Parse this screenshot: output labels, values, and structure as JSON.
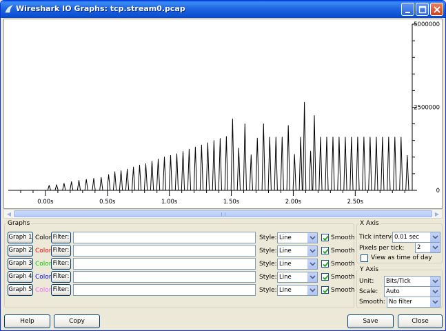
{
  "window": {
    "title": "Wireshark IO Graphs: tcp.stream0.pcap"
  },
  "chart_data": {
    "type": "line",
    "x_tick_labels": [
      "0.00s",
      "0.50s",
      "1.00s",
      "1.50s",
      "2.00s",
      "2.50s"
    ],
    "x_ticks": [
      0.0,
      0.5,
      1.0,
      1.5,
      2.0,
      2.5
    ],
    "y_tick_labels": [
      "5000000",
      "2500000",
      "0"
    ],
    "y_ticks": [
      5000000,
      2500000,
      0
    ],
    "xlim": [
      -0.3,
      2.96
    ],
    "ylim": [
      0,
      5000000
    ],
    "peaks": [
      [
        0.03,
        150000
      ],
      [
        0.09,
        170000
      ],
      [
        0.15,
        210000
      ],
      [
        0.21,
        260000
      ],
      [
        0.27,
        300000
      ],
      [
        0.33,
        330000
      ],
      [
        0.39,
        360000
      ],
      [
        0.45,
        390000
      ],
      [
        0.51,
        470000
      ],
      [
        0.56,
        560000
      ],
      [
        0.61,
        590000
      ],
      [
        0.66,
        640000
      ],
      [
        0.71,
        700000
      ],
      [
        0.76,
        760000
      ],
      [
        0.81,
        800000
      ],
      [
        0.86,
        880000
      ],
      [
        0.91,
        940000
      ],
      [
        0.96,
        1000000
      ],
      [
        1.01,
        1050000
      ],
      [
        1.06,
        1100000
      ],
      [
        1.11,
        1170000
      ],
      [
        1.16,
        1240000
      ],
      [
        1.21,
        1300000
      ],
      [
        1.26,
        1360000
      ],
      [
        1.31,
        1430000
      ],
      [
        1.36,
        1500000
      ],
      [
        1.41,
        1560000
      ],
      [
        1.46,
        1620000
      ],
      [
        1.51,
        2150000
      ],
      [
        1.56,
        1270000
      ],
      [
        1.61,
        2000000
      ],
      [
        1.66,
        1070000
      ],
      [
        1.71,
        1570000
      ],
      [
        1.76,
        2000000
      ],
      [
        1.81,
        1600000
      ],
      [
        1.86,
        1600000
      ],
      [
        1.91,
        1600000
      ],
      [
        1.96,
        1950000
      ],
      [
        2.01,
        1080000
      ],
      [
        2.06,
        1600000
      ],
      [
        2.09,
        2650000
      ],
      [
        2.14,
        1180000
      ],
      [
        2.17,
        2250000
      ],
      [
        2.22,
        1600000
      ],
      [
        2.27,
        1600000
      ],
      [
        2.32,
        1600000
      ],
      [
        2.37,
        1600000
      ],
      [
        2.42,
        1600000
      ],
      [
        2.47,
        1600000
      ],
      [
        2.52,
        1600000
      ],
      [
        2.57,
        1600000
      ],
      [
        2.62,
        1600000
      ],
      [
        2.67,
        1600000
      ],
      [
        2.72,
        1600000
      ],
      [
        2.77,
        1600000
      ],
      [
        2.82,
        1600000
      ],
      [
        2.87,
        1600000
      ],
      [
        2.92,
        1050000
      ]
    ],
    "grid": false
  },
  "graphs": {
    "legend": "Graphs",
    "color_label": "Color",
    "filter_label": "Filter:",
    "style_label": "Style:",
    "smooth_label": "Smooth",
    "rows": [
      {
        "button": "Graph 1",
        "color": "#000000",
        "style": "Line",
        "smooth": true,
        "filter": ""
      },
      {
        "button": "Graph 2",
        "color": "#FF0000",
        "style": "Line",
        "smooth": true,
        "filter": ""
      },
      {
        "button": "Graph 3",
        "color": "#00CC00",
        "style": "Line",
        "smooth": true,
        "filter": ""
      },
      {
        "button": "Graph 4",
        "color": "#0000FF",
        "style": "Line",
        "smooth": true,
        "filter": ""
      },
      {
        "button": "Graph 5",
        "color": "#FF66FF",
        "style": "Line",
        "smooth": true,
        "filter": ""
      }
    ]
  },
  "x_axis": {
    "legend": "X Axis",
    "tick_interval_label": "Tick interval:",
    "tick_interval_value": "0.01 sec",
    "pixels_per_tick_label": "Pixels per tick:",
    "pixels_per_tick_value": "2",
    "time_of_day_label": "View as time of day",
    "time_of_day_checked": false
  },
  "y_axis": {
    "legend": "Y Axis",
    "unit_label": "Unit:",
    "unit_value": "Bits/Tick",
    "scale_label": "Scale:",
    "scale_value": "Auto",
    "smooth_label": "Smooth:",
    "smooth_value": "No filter"
  },
  "buttons": {
    "help": "Help",
    "copy": "Copy",
    "save": "Save",
    "close": "Close"
  }
}
